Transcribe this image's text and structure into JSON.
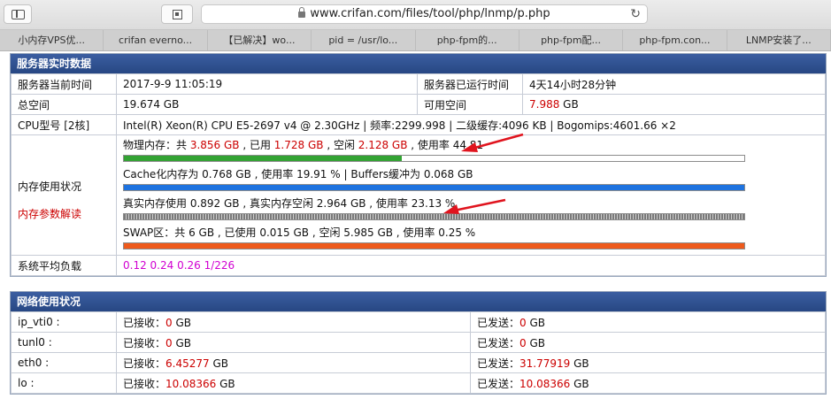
{
  "browser": {
    "url": "www.crifan.com/files/tool/php/lnmp/p.php",
    "tabs": [
      "小内存VPS优...",
      "crifan everno...",
      "【已解决】wo...",
      "pid = /usr/lo...",
      "php-fpm的...",
      "php-fpm配...",
      "php-fpm.con...",
      "LNMP安装了..."
    ]
  },
  "server": {
    "title": "服务器实时数据",
    "current_time_label": "服务器当前时间",
    "current_time": "2017-9-9 11:05:19",
    "uptime_label": "服务器已运行时间",
    "uptime": "4天14小时28分钟",
    "total_space_label": "总空间",
    "total_space": "19.674 GB",
    "free_space_label": "可用空间",
    "free_space_value": "7.988",
    "free_space_unit": " GB",
    "cpu_label": "CPU型号 [2核]",
    "cpu_info": "Intel(R) Xeon(R) CPU E5-2697 v4 @ 2.30GHz | 频率:2299.998 | 二级缓存:4096 KB | Bogomips:4601.66 ×2",
    "memory_label": "内存使用状况",
    "memory_help_link": "内存参数解读",
    "load_label": "系统平均负载",
    "load_value": "0.12 0.24 0.26 1/226"
  },
  "memory": {
    "physical": {
      "prefix": "物理内存：共 ",
      "total": "3.856 GB",
      "used_prefix": " , 已用 ",
      "used": "1.728 GB",
      "free_prefix": " , 空闲 ",
      "free": "2.128 GB",
      "rate_text": " , 使用率 44.81",
      "percent": 44.81
    },
    "cache": {
      "text": "Cache化内存为 0.768 GB , 使用率 19.91 % | Buffers缓冲为 0.068 GB",
      "percent": 100
    },
    "real": {
      "text": "真实内存使用 0.892 GB , 真实内存空闲 2.964 GB , 使用率 23.13 %",
      "percent": 100
    },
    "swap": {
      "text": "SWAP区：共 6 GB , 已使用 0.015 GB , 空闲 5.985 GB , 使用率 0.25 %",
      "percent": 100
    }
  },
  "network": {
    "title": "网络使用状况",
    "recv_label": "已接收：",
    "send_label": "已发送：",
    "unit": " GB",
    "rows": [
      {
        "iface": "ip_vti0 :",
        "recv": "0",
        "sent": "0"
      },
      {
        "iface": "tunl0 :",
        "recv": "0",
        "sent": "0"
      },
      {
        "iface": "eth0 :",
        "recv": "6.45277",
        "sent": "31.77919"
      },
      {
        "iface": "lo :",
        "recv": "10.08366",
        "sent": "10.08366"
      }
    ]
  },
  "colors": {
    "header_blue": "#2f4e8e",
    "value_red": "#cc0000",
    "load_magenta": "#d100d1",
    "bar_green": "#33a333",
    "bar_blue": "#1e73e0",
    "bar_orange": "#ee5a1c",
    "annotation_arrow": "#e0141e"
  }
}
